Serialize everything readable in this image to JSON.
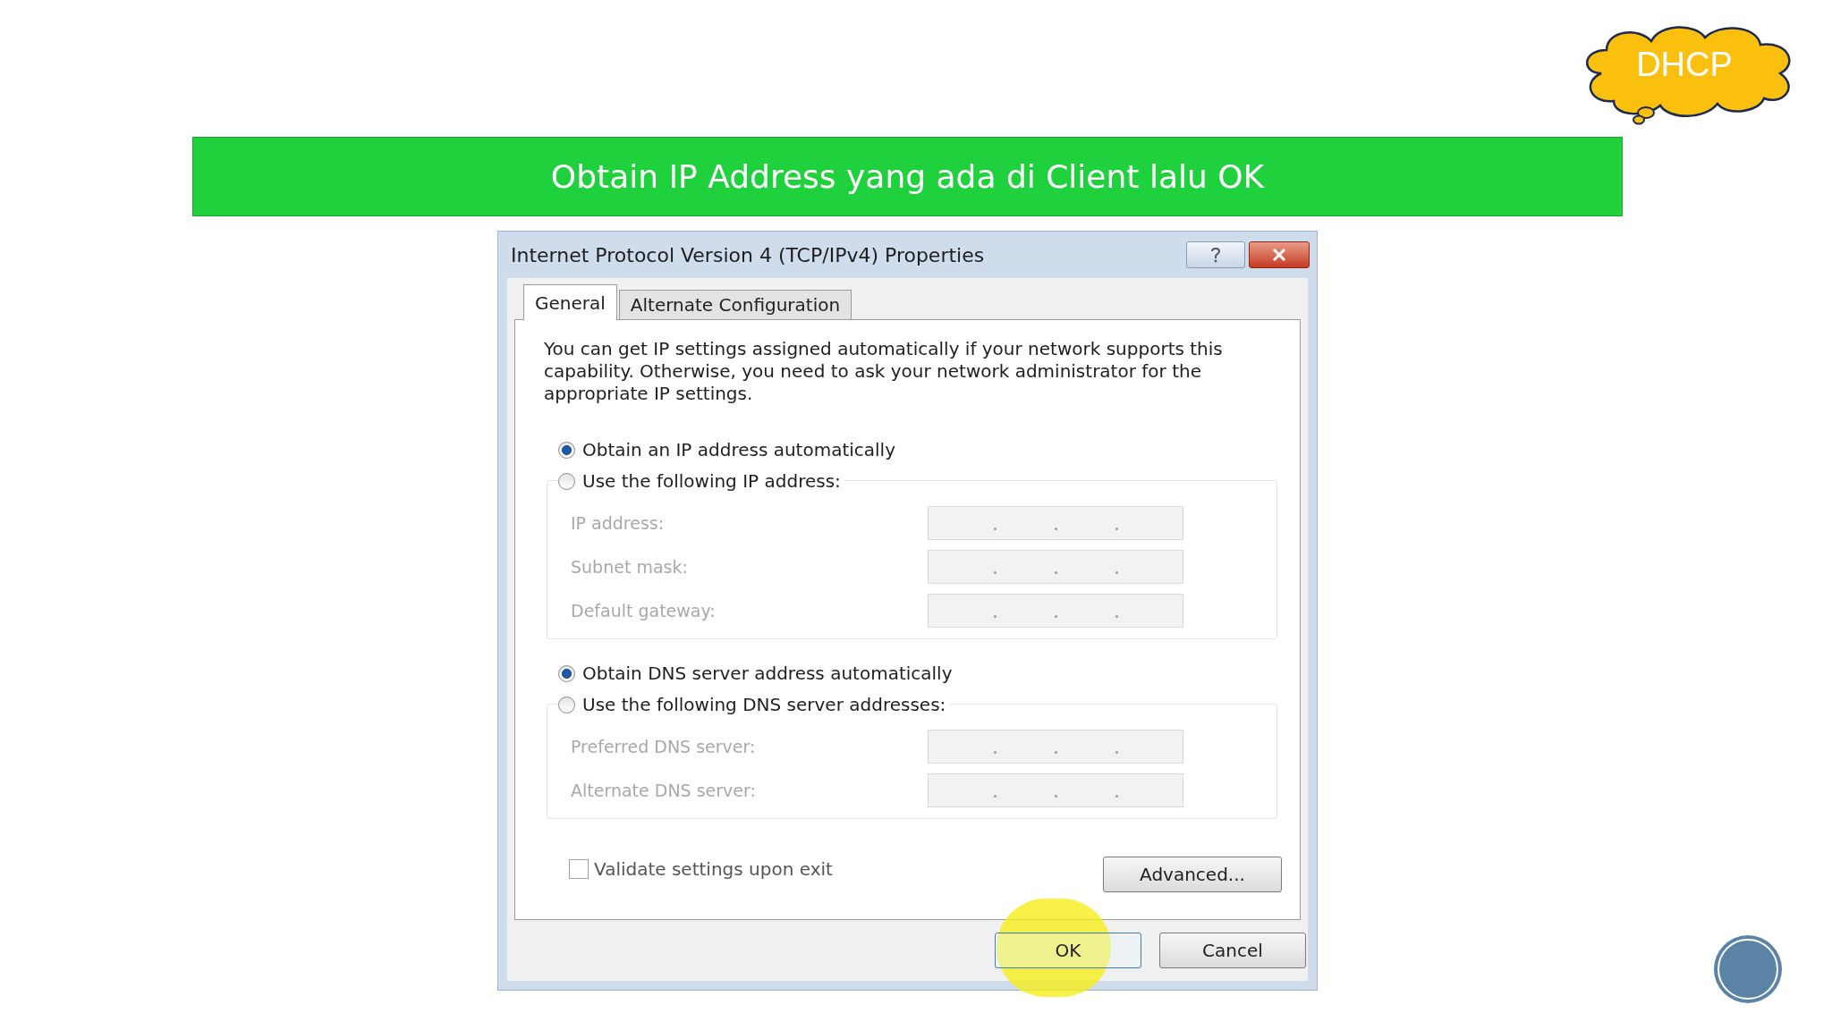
{
  "cloud": {
    "label": "DHCP"
  },
  "banner": {
    "text": "Obtain IP Address yang ada di Client lalu OK"
  },
  "dialog": {
    "title": "Internet Protocol Version 4 (TCP/IPv4) Properties",
    "tabs": [
      {
        "label": "General",
        "selected": true
      },
      {
        "label": "Alternate Configuration",
        "selected": false
      }
    ],
    "description": "You can get IP settings assigned automatically if your network supports this capability. Otherwise, you need to ask your network administrator for the appropriate IP settings.",
    "sections": [
      {
        "options": [
          {
            "label": "Obtain an IP address automatically",
            "selected": true
          },
          {
            "label": "Use the following IP address:",
            "selected": false
          }
        ],
        "disabled": true,
        "fields": [
          {
            "label": "IP address:"
          },
          {
            "label": "Subnet mask:"
          },
          {
            "label": "Default gateway:"
          }
        ]
      },
      {
        "options": [
          {
            "label": "Obtain DNS server address automatically",
            "selected": true
          },
          {
            "label": "Use the following DNS server addresses:",
            "selected": false
          }
        ],
        "disabled": true,
        "fields": [
          {
            "label": "Preferred DNS server:"
          },
          {
            "label": "Alternate DNS server:"
          }
        ]
      }
    ],
    "validate": {
      "label": "Validate settings upon exit",
      "checked": false
    },
    "advanced_button": "Advanced...",
    "buttons": [
      {
        "label": "OK",
        "highlighted": true
      },
      {
        "label": "Cancel",
        "highlighted": false
      }
    ]
  }
}
